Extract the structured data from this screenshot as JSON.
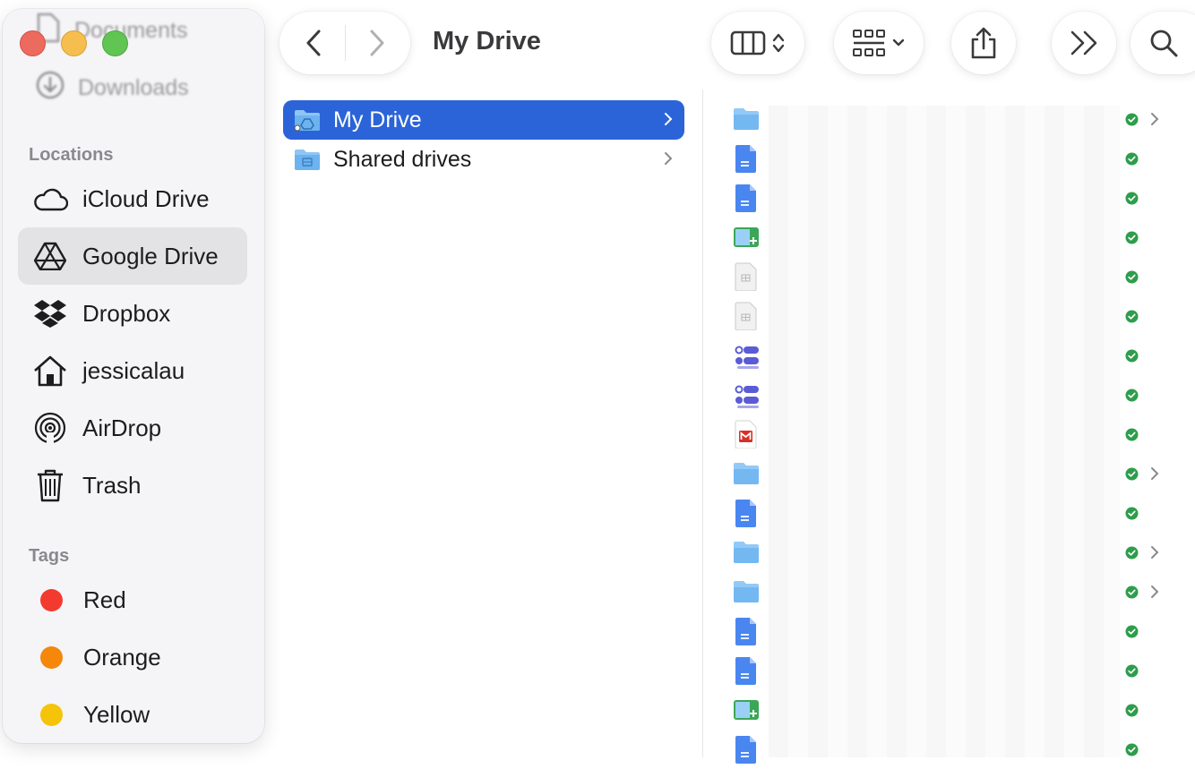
{
  "window": {
    "title": "My Drive"
  },
  "sidebar": {
    "ghost_items": [
      {
        "label": "Documents"
      },
      {
        "label": "Downloads"
      }
    ],
    "locations_header": "Locations",
    "locations": [
      {
        "label": "iCloud Drive",
        "icon": "cloud-icon"
      },
      {
        "label": "Google Drive",
        "icon": "google-drive-icon",
        "selected": true
      },
      {
        "label": "Dropbox",
        "icon": "dropbox-icon"
      },
      {
        "label": "jessicalau",
        "icon": "home-icon"
      },
      {
        "label": "AirDrop",
        "icon": "airdrop-icon"
      },
      {
        "label": "Trash",
        "icon": "trash-icon"
      }
    ],
    "tags_header": "Tags",
    "tags": [
      {
        "label": "Red",
        "color": "#f23a2f"
      },
      {
        "label": "Orange",
        "color": "#f5870a"
      },
      {
        "label": "Yellow",
        "color": "#f5c30a"
      }
    ]
  },
  "toolbar": {
    "back_icon": "chevron-left-icon",
    "forward_icon": "chevron-right-icon",
    "view_icon": "column-view-icon",
    "group_icon": "group-grid-icon",
    "share_icon": "share-icon",
    "more_icon": "double-chevron-icon",
    "search_icon": "search-icon"
  },
  "column1": {
    "items": [
      {
        "label": "My Drive",
        "selected": true
      },
      {
        "label": "Shared drives",
        "selected": false
      }
    ]
  },
  "column2": {
    "files": [
      {
        "type": "folder",
        "status": "synced",
        "has_children": true
      },
      {
        "type": "doc",
        "status": "synced",
        "has_children": false
      },
      {
        "type": "doc",
        "status": "synced",
        "has_children": false
      },
      {
        "type": "slides",
        "status": "synced",
        "has_children": false
      },
      {
        "type": "sheet-file",
        "status": "synced",
        "has_children": false
      },
      {
        "type": "sheet-file",
        "status": "synced",
        "has_children": false
      },
      {
        "type": "form",
        "status": "synced",
        "has_children": false
      },
      {
        "type": "form",
        "status": "synced",
        "has_children": false
      },
      {
        "type": "gmail",
        "status": "synced",
        "has_children": false
      },
      {
        "type": "folder",
        "status": "synced",
        "has_children": true
      },
      {
        "type": "doc",
        "status": "synced",
        "has_children": false
      },
      {
        "type": "folder",
        "status": "synced",
        "has_children": true
      },
      {
        "type": "folder",
        "status": "synced",
        "has_children": true
      },
      {
        "type": "doc",
        "status": "synced",
        "has_children": false
      },
      {
        "type": "doc",
        "status": "synced",
        "has_children": false
      },
      {
        "type": "slides",
        "status": "synced",
        "has_children": false
      },
      {
        "type": "doc",
        "status": "synced",
        "has_children": false
      }
    ]
  }
}
